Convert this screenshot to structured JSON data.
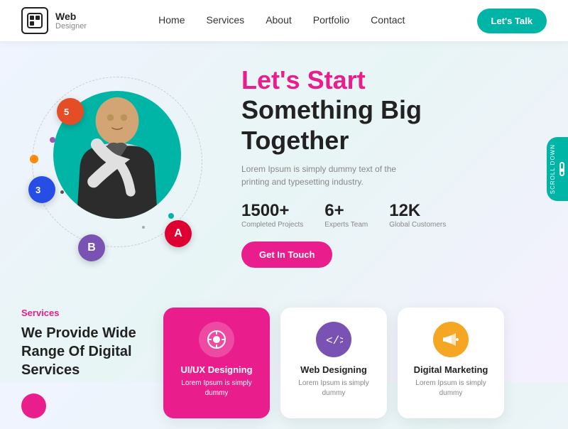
{
  "navbar": {
    "logo": {
      "icon": "◻",
      "brand": "Web",
      "sub": "Designer"
    },
    "links": [
      {
        "label": "Home",
        "id": "home"
      },
      {
        "label": "Services",
        "id": "services"
      },
      {
        "label": "About",
        "id": "about"
      },
      {
        "label": "Portfolio",
        "id": "portfolio"
      },
      {
        "label": "Contact",
        "id": "contact"
      }
    ],
    "cta_label": "Let's Talk"
  },
  "hero": {
    "title_pink": "Let's Start",
    "title_black_line1": "Something Big",
    "title_black_line2": "Together",
    "description": "Lorem Ipsum is simply dummy text of the printing and typesetting industry.",
    "stats": [
      {
        "number": "1500+",
        "label": "Completed Projects"
      },
      {
        "number": "6+",
        "label": "Experts Team"
      },
      {
        "number": "12K",
        "label": "Global Customers"
      }
    ],
    "btn_label": "Get In Touch",
    "scroll_label": "Scroll Down"
  },
  "badges": [
    {
      "id": "html5",
      "letter": "5",
      "title": "HTML5"
    },
    {
      "id": "css3",
      "letter": "3",
      "title": "CSS3"
    },
    {
      "id": "angular",
      "letter": "A",
      "title": "Angular"
    },
    {
      "id": "bootstrap",
      "letter": "B",
      "title": "Bootstrap"
    }
  ],
  "services": {
    "section_label": "Services",
    "section_title": "We Provide Wide Range Of Digital Services",
    "cards": [
      {
        "id": "uiux",
        "name": "UI/UX Designing",
        "icon_symbol": "⊞",
        "icon_bg": "#e91e8c",
        "desc": "Lorem Ipsum is simply dummy",
        "active": true
      },
      {
        "id": "webdesign",
        "name": "Web Designing",
        "icon_symbol": "</>",
        "icon_bg": "#7952b3",
        "desc": "Lorem Ipsum is simply dummy",
        "active": false
      },
      {
        "id": "marketing",
        "name": "Digital Marketing",
        "icon_symbol": "📣",
        "icon_bg": "#f5a623",
        "desc": "Lorem Ipsum is simply dummy",
        "active": false
      }
    ]
  }
}
